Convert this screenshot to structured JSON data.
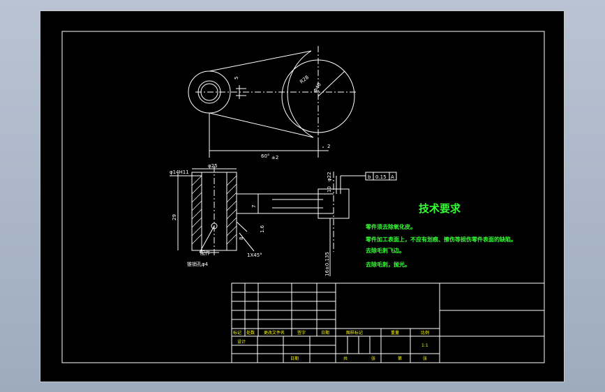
{
  "drawing": {
    "dimensions": {
      "r28": "R28",
      "phi40": "Φ40",
      "five": "5",
      "two": "2",
      "angle": "60°",
      "angle_tol": "±2",
      "phi25": "φ25",
      "phi14": "φ14H11",
      "h29": "29",
      "seven": "7",
      "ra16": "1.6",
      "eight": "8",
      "chamfer": "1X45°",
      "phi22": "φ22",
      "ten": "10",
      "sixteen": "16±0.135"
    },
    "fcf": {
      "symbol": "b",
      "value": "0.15",
      "datum": "A"
    },
    "notes": {
      "pin": "配作",
      "hole": "锥销孔φ4"
    }
  },
  "technical_requirements": {
    "title": "技术要求",
    "items": [
      "零件须去除氧化皮。",
      "零件加工表面上，不应有划痕、擦伤等损伤零件表面的缺陷。",
      "去除毛刺飞边。",
      "去除毛刺，抛光。"
    ]
  },
  "title_block": {
    "labels": {
      "mark": "标记",
      "count": "处数",
      "change_doc": "更改文件名",
      "signature": "签字",
      "date": "日期",
      "design": "设计",
      "date2": "日期",
      "stage": "图样标记",
      "weight": "重量",
      "scale": "比例",
      "scale_value": "1:1",
      "total": "共",
      "sheets": "张",
      "sheet_no": "第",
      "sheet_suffix": "张"
    }
  },
  "colors": {
    "sheet": "#000000",
    "lines": "#ffffff",
    "notes": "#33ff33",
    "labels": "#ffff00"
  }
}
